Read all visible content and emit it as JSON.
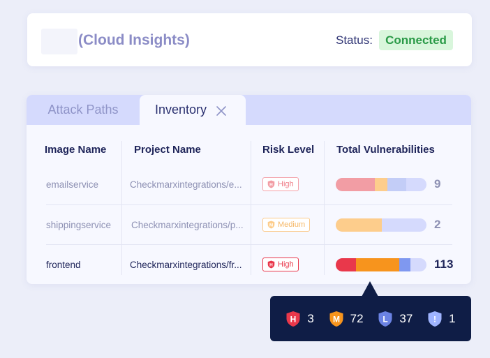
{
  "header": {
    "app_title": "(Cloud Insights)",
    "status_label": "Status:",
    "status_value": "Connected",
    "status_color": "#2a9a47"
  },
  "tabs": [
    {
      "label": "Attack Paths",
      "active": false
    },
    {
      "label": "Inventory",
      "active": true,
      "icon": "close-icon"
    }
  ],
  "table": {
    "columns": [
      "Image Name",
      "Project Name",
      "Risk Level",
      "Total Vulnerabilities"
    ],
    "rows": [
      {
        "image": "emailservice",
        "project": "Checkmarxintegrations/e...",
        "risk": "High",
        "risk_icon": "high-shield-icon",
        "total": "9",
        "bar": {
          "high": 0.43,
          "medium": 0.14,
          "low": 0.21
        }
      },
      {
        "image": "shippingservice",
        "project": "Checkmarxintegrations/p...",
        "risk": "Medium",
        "risk_icon": "medium-shield-icon",
        "total": "2",
        "bar": {
          "high": 0,
          "medium": 0.51,
          "low": 0
        }
      },
      {
        "image": "frontend",
        "project": "Checkmarxintegrations/fr...",
        "risk": "High",
        "risk_icon": "high-shield-icon",
        "total": "113",
        "bar": {
          "high": 0.22,
          "medium": 0.48,
          "low": 0.12
        }
      }
    ]
  },
  "tooltip": {
    "items": [
      {
        "letter": "H",
        "count": "3",
        "icon": "high-shield-icon",
        "color": "#e9384b"
      },
      {
        "letter": "M",
        "count": "72",
        "icon": "medium-shield-icon",
        "color": "#f7941d"
      },
      {
        "letter": "L",
        "count": "37",
        "icon": "low-shield-icon",
        "color": "#6b83e4"
      },
      {
        "letter": "!",
        "count": "1",
        "icon": "info-shield-icon",
        "color": "#9fb4ff"
      }
    ]
  },
  "colors": {
    "high": "#e9384b",
    "medium": "#f7941d",
    "low": "#7f98f0",
    "track": "#d5dafd",
    "high_muted": "#f29da4",
    "medium_muted": "#fdcd8c",
    "low_muted": "#c3cdf7"
  }
}
